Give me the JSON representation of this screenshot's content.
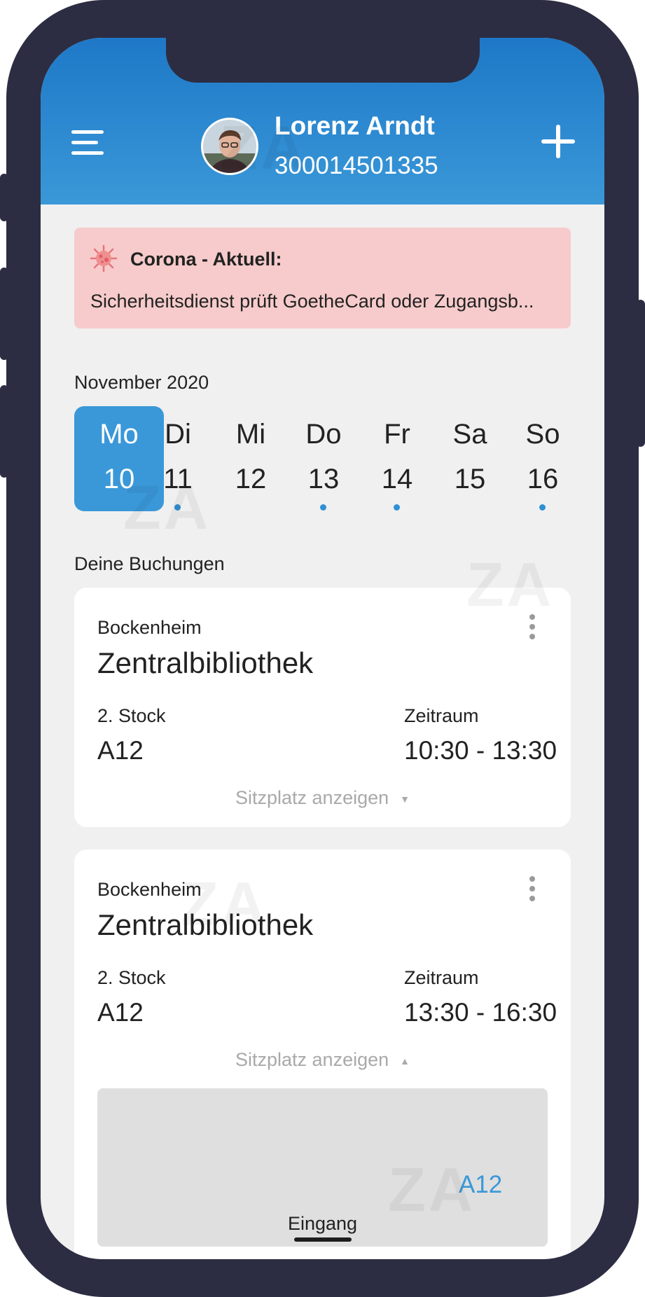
{
  "header": {
    "user_name": "Lorenz Arndt",
    "user_id": "300014501335",
    "menu_icon": "hamburger-menu-icon",
    "add_icon": "plus-icon",
    "colors": {
      "top": "#1e78c7",
      "bottom": "#3a98d8"
    }
  },
  "alert": {
    "icon": "virus-icon",
    "title": "Corona - Aktuell:",
    "text": "Sicherheitsdienst prüft GoetheCard oder Zugangsb...",
    "background": "#f7cbcb"
  },
  "calendar": {
    "month": "November 2020",
    "days": [
      {
        "name": "Mo",
        "num": "10",
        "selected": true,
        "has_event": false
      },
      {
        "name": "Di",
        "num": "11",
        "selected": false,
        "has_event": true
      },
      {
        "name": "Mi",
        "num": "12",
        "selected": false,
        "has_event": false
      },
      {
        "name": "Do",
        "num": "13",
        "selected": false,
        "has_event": true
      },
      {
        "name": "Fr",
        "num": "14",
        "selected": false,
        "has_event": true
      },
      {
        "name": "Sa",
        "num": "15",
        "selected": false,
        "has_event": false
      },
      {
        "name": "So",
        "num": "16",
        "selected": false,
        "has_event": true
      }
    ],
    "accent": "#3a98d8"
  },
  "bookings": {
    "label": "Deine Buchungen",
    "items": [
      {
        "area": "Bockenheim",
        "title": "Zentralbibliothek",
        "floor": "2. Stock",
        "seat": "A12",
        "time_label": "Zeitraum",
        "time": "10:30 - 13:30",
        "show_seat": "Sitzplatz anzeigen",
        "expanded": false
      },
      {
        "area": "Bockenheim",
        "title": "Zentralbibliothek",
        "floor": "2. Stock",
        "seat": "A12",
        "time_label": "Zeitraum",
        "time": "13:30 - 16:30",
        "show_seat": "Sitzplatz anzeigen",
        "expanded": true,
        "seat_map": {
          "seat_label": "A12",
          "entrance_label": "Eingang"
        }
      }
    ]
  },
  "watermark": "ZA"
}
